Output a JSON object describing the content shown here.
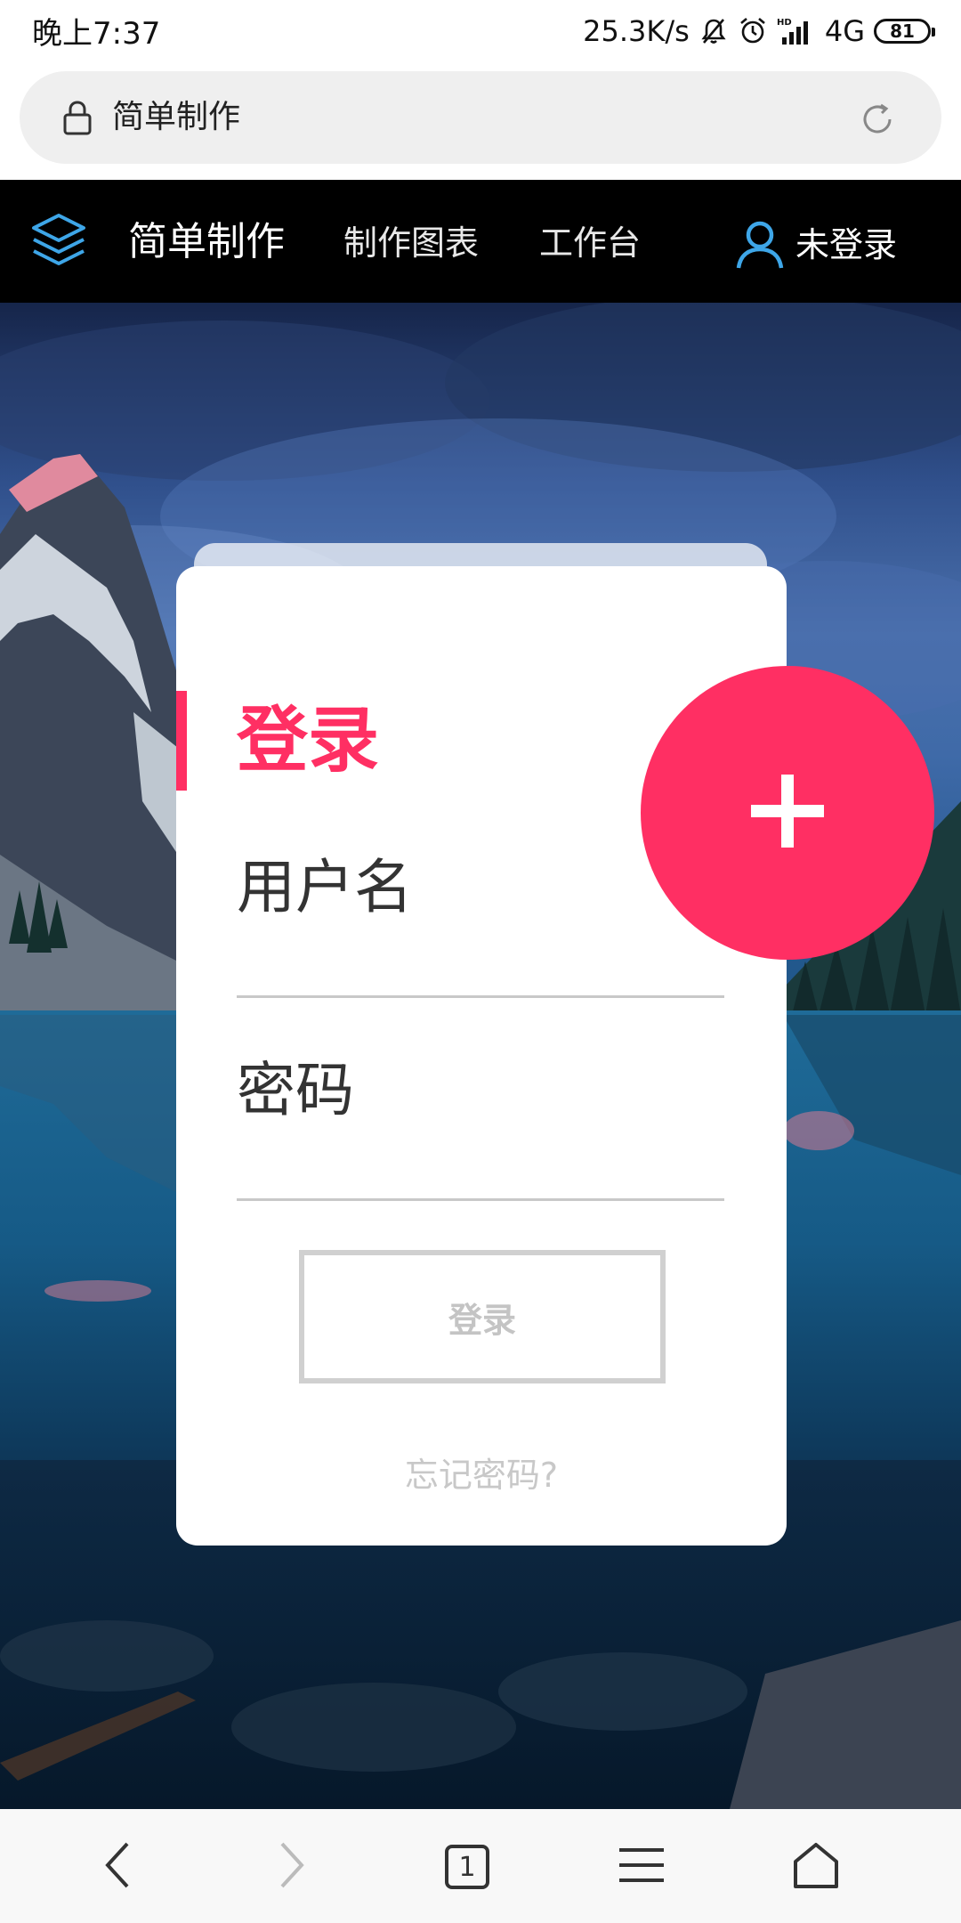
{
  "status_bar": {
    "time": "晚上7:37",
    "network_speed": "25.3K/s",
    "network_type": "4G",
    "battery": "81"
  },
  "address_bar": {
    "page_title": "简单制作"
  },
  "site_nav": {
    "brand": "简单制作",
    "links": [
      {
        "label": "制作图表"
      },
      {
        "label": "工作台"
      }
    ],
    "user_status": "未登录"
  },
  "login_card": {
    "title": "登录",
    "username_label": "用户名",
    "password_label": "密码",
    "submit_label": "登录",
    "forgot_password": "忘记密码?"
  },
  "colors": {
    "accent": "#ff2f63",
    "nav_background": "#000000",
    "nav_icon": "#3ea6e8"
  },
  "toolbar": {
    "tab_count": "1"
  }
}
